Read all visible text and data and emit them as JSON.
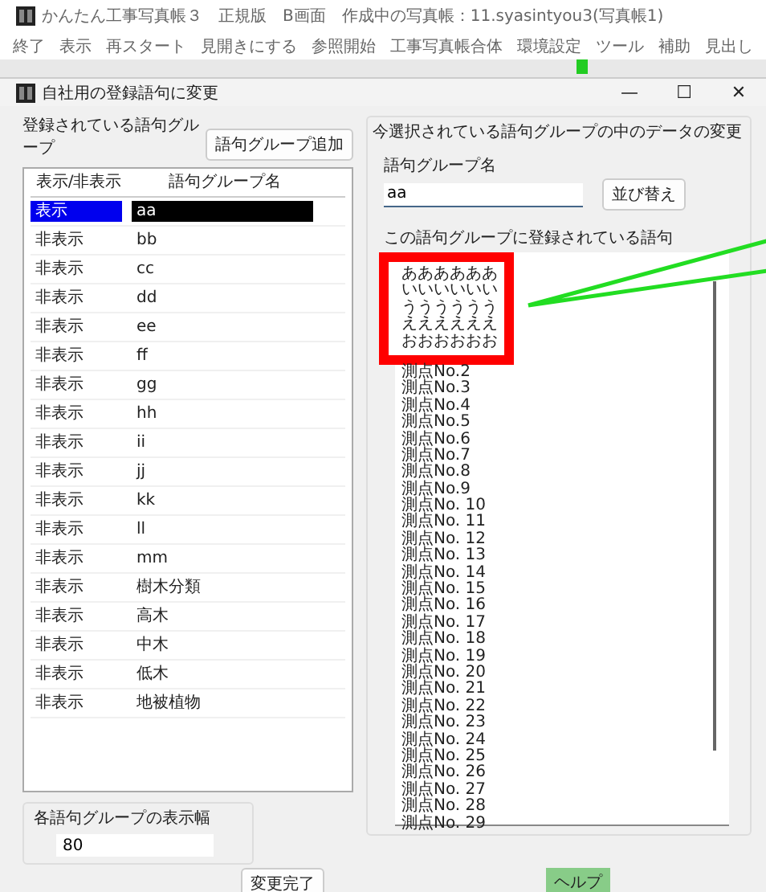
{
  "app_window": {
    "title": "かんたん工事写真帳３　正規版　B画面　作成中の写真帳：11.syasintyou3(写真帳1)",
    "menu": [
      "終了",
      "表示",
      "再スタート",
      "見開きにする",
      "参照開始",
      "工事写真帳合体",
      "環境設定",
      "ツール",
      "補助",
      "見出し"
    ]
  },
  "dialog": {
    "title": "自社用の登録語句に変更",
    "controls": [
      "—",
      "☐",
      "✕"
    ]
  },
  "groups": {
    "label": "登録されている語句グループ",
    "add_button": "語句グループ追加",
    "columns": [
      "表示/非表示",
      "語句グループ名"
    ],
    "rows": [
      {
        "visibility": "表示",
        "name": "aa",
        "selected": true
      },
      {
        "visibility": "非表示",
        "name": "bb",
        "selected": false
      },
      {
        "visibility": "非表示",
        "name": "cc",
        "selected": false
      },
      {
        "visibility": "非表示",
        "name": "dd",
        "selected": false
      },
      {
        "visibility": "非表示",
        "name": "ee",
        "selected": false
      },
      {
        "visibility": "非表示",
        "name": "ff",
        "selected": false
      },
      {
        "visibility": "非表示",
        "name": "gg",
        "selected": false
      },
      {
        "visibility": "非表示",
        "name": "hh",
        "selected": false
      },
      {
        "visibility": "非表示",
        "name": "ii",
        "selected": false
      },
      {
        "visibility": "非表示",
        "name": "jj",
        "selected": false
      },
      {
        "visibility": "非表示",
        "name": "kk",
        "selected": false
      },
      {
        "visibility": "非表示",
        "name": "ll",
        "selected": false
      },
      {
        "visibility": "非表示",
        "name": "mm",
        "selected": false
      },
      {
        "visibility": "非表示",
        "name": "樹木分類",
        "selected": false
      },
      {
        "visibility": "非表示",
        "name": "高木",
        "selected": false
      },
      {
        "visibility": "非表示",
        "name": "中木",
        "selected": false
      },
      {
        "visibility": "非表示",
        "name": "低木",
        "selected": false
      },
      {
        "visibility": "非表示",
        "name": "地被植物",
        "selected": false
      }
    ],
    "width_group": {
      "label": "各語句グループの表示幅",
      "value": "80"
    }
  },
  "editor": {
    "legend": "今選択されている語句グループの中のデータの変更",
    "name_label": "語句グループ名",
    "name_value": "aa",
    "sort_button": "並び替え",
    "phrases_label": "この語句グループに登録されている語句",
    "highlighted_phrases": [
      "ああああああ",
      "いいいいいい",
      "うううううう",
      "ええええええ",
      "おおおおおお"
    ],
    "phrases": [
      "測点No.2",
      "測点No.3",
      "測点No.4",
      "測点No.5",
      "測点No.6",
      "測点No.7",
      "測点No.8",
      "測点No.9",
      "測点No. 10",
      "測点No. 11",
      "測点No. 12",
      "測点No. 13",
      "測点No. 14",
      "測点No. 15",
      "測点No. 16",
      "測点No. 17",
      "測点No. 18",
      "測点No. 19",
      "測点No. 20",
      "測点No. 21",
      "測点No. 22",
      "測点No. 23",
      "測点No. 24",
      "測点No. 25",
      "測点No. 26",
      "測点No. 27",
      "測点No. 28",
      "測点No. 29"
    ]
  },
  "buttons": {
    "done": "変更完了",
    "help": "ヘルプ"
  }
}
